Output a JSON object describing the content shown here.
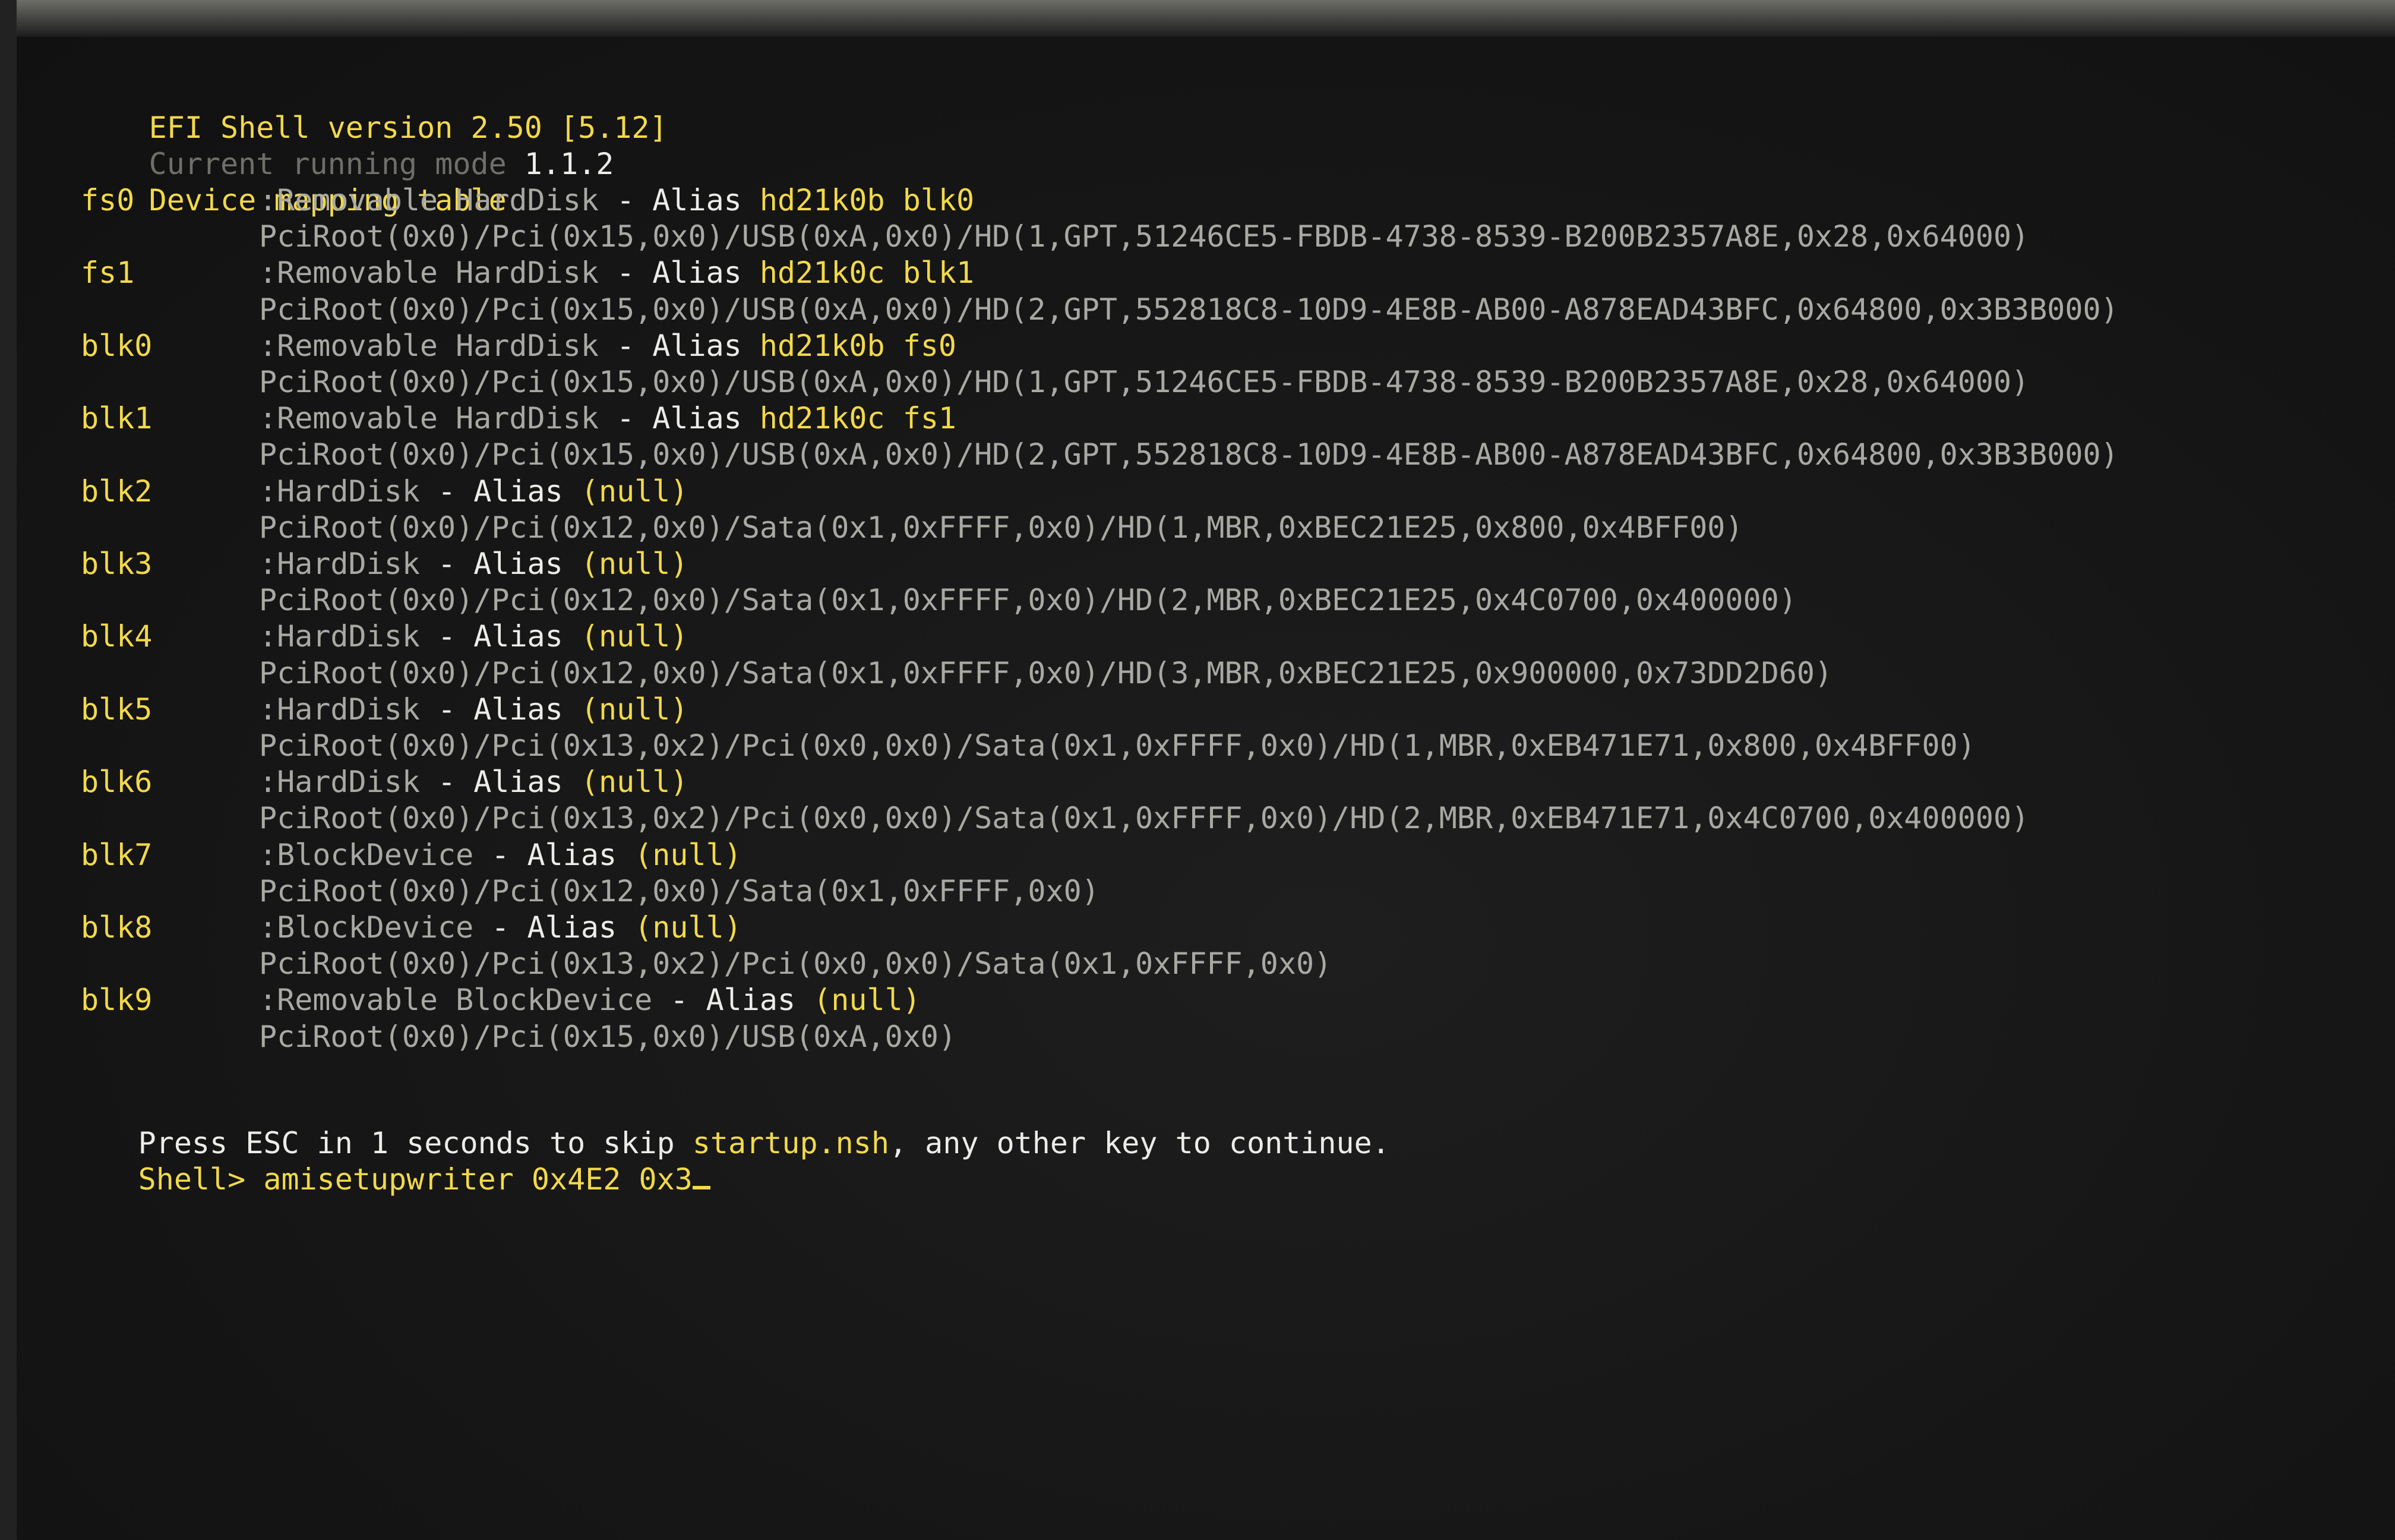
{
  "header": {
    "version": "EFI Shell version 2.50 [5.12]",
    "mode_label": "Current running mode",
    "mode_value": "1.1.2",
    "table_title": "Device mapping table"
  },
  "devices": [
    {
      "name": "fs0",
      "type": ":Removable HardDisk",
      "sep": "- Alias",
      "alias": "hd21k0b blk0",
      "path": "PciRoot(0x0)/Pci(0x15,0x0)/USB(0xA,0x0)/HD(1,GPT,51246CE5-FBDB-4738-8539-B200B2357A8E,0x28,0x64000)"
    },
    {
      "name": "fs1",
      "type": ":Removable HardDisk",
      "sep": "- Alias",
      "alias": "hd21k0c blk1",
      "path": "PciRoot(0x0)/Pci(0x15,0x0)/USB(0xA,0x0)/HD(2,GPT,552818C8-10D9-4E8B-AB00-A878EAD43BFC,0x64800,0x3B3B000)"
    },
    {
      "name": "blk0",
      "type": ":Removable HardDisk",
      "sep": "- Alias",
      "alias": "hd21k0b fs0",
      "path": "PciRoot(0x0)/Pci(0x15,0x0)/USB(0xA,0x0)/HD(1,GPT,51246CE5-FBDB-4738-8539-B200B2357A8E,0x28,0x64000)"
    },
    {
      "name": "blk1",
      "type": ":Removable HardDisk",
      "sep": "- Alias",
      "alias": "hd21k0c fs1",
      "path": "PciRoot(0x0)/Pci(0x15,0x0)/USB(0xA,0x0)/HD(2,GPT,552818C8-10D9-4E8B-AB00-A878EAD43BFC,0x64800,0x3B3B000)"
    },
    {
      "name": "blk2",
      "type": ":HardDisk",
      "sep": "- Alias",
      "alias": "(null)",
      "path": "PciRoot(0x0)/Pci(0x12,0x0)/Sata(0x1,0xFFFF,0x0)/HD(1,MBR,0xBEC21E25,0x800,0x4BFF00)"
    },
    {
      "name": "blk3",
      "type": ":HardDisk",
      "sep": "- Alias",
      "alias": "(null)",
      "path": "PciRoot(0x0)/Pci(0x12,0x0)/Sata(0x1,0xFFFF,0x0)/HD(2,MBR,0xBEC21E25,0x4C0700,0x400000)"
    },
    {
      "name": "blk4",
      "type": ":HardDisk",
      "sep": "- Alias",
      "alias": "(null)",
      "path": "PciRoot(0x0)/Pci(0x12,0x0)/Sata(0x1,0xFFFF,0x0)/HD(3,MBR,0xBEC21E25,0x900000,0x73DD2D60)"
    },
    {
      "name": "blk5",
      "type": ":HardDisk",
      "sep": "- Alias",
      "alias": "(null)",
      "path": "PciRoot(0x0)/Pci(0x13,0x2)/Pci(0x0,0x0)/Sata(0x1,0xFFFF,0x0)/HD(1,MBR,0xEB471E71,0x800,0x4BFF00)"
    },
    {
      "name": "blk6",
      "type": ":HardDisk",
      "sep": "- Alias",
      "alias": "(null)",
      "path": "PciRoot(0x0)/Pci(0x13,0x2)/Pci(0x0,0x0)/Sata(0x1,0xFFFF,0x0)/HD(2,MBR,0xEB471E71,0x4C0700,0x400000)"
    },
    {
      "name": "blk7",
      "type": ":BlockDevice",
      "sep": "- Alias",
      "alias": "(null)",
      "path": "PciRoot(0x0)/Pci(0x12,0x0)/Sata(0x1,0xFFFF,0x0)"
    },
    {
      "name": "blk8",
      "type": ":BlockDevice",
      "sep": "- Alias",
      "alias": "(null)",
      "path": "PciRoot(0x0)/Pci(0x13,0x2)/Pci(0x0,0x0)/Sata(0x1,0xFFFF,0x0)"
    },
    {
      "name": "blk9",
      "type": ":Removable BlockDevice",
      "sep": "- Alias",
      "alias": "(null)",
      "path": "PciRoot(0x0)/Pci(0x15,0x0)/USB(0xA,0x0)"
    }
  ],
  "startup": {
    "p1": "Press ",
    "esc": "ESC",
    "p2": " in 1 seconds to skip ",
    "file": "startup.nsh",
    "p3": ", any other key to continue."
  },
  "prompt": {
    "label": "Shell>",
    "command": "amisetupwriter 0x4E2 0x3"
  },
  "colors": {
    "yellow": "#f2d94a",
    "white": "#ecece8",
    "gray": "#a9a9a4"
  }
}
